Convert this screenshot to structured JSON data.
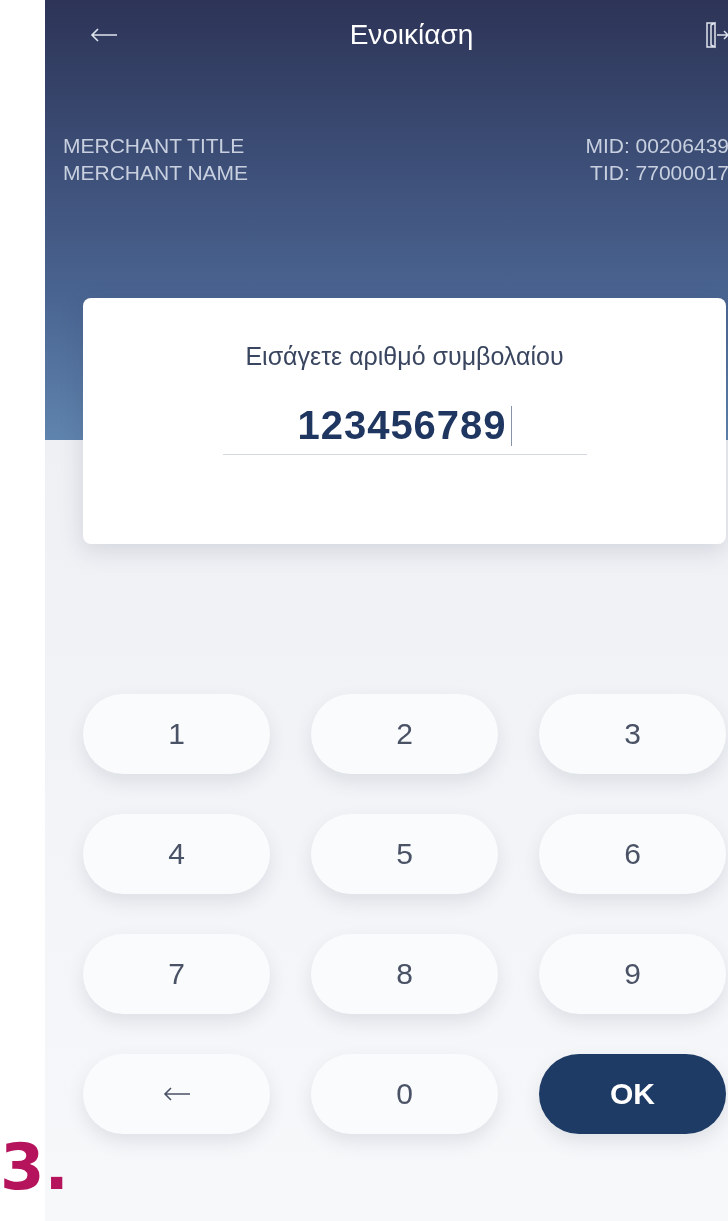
{
  "header": {
    "title": "Ενοικίαση"
  },
  "merchant": {
    "title": "MERCHANT TITLE",
    "name": "MERCHANT NAME",
    "mid": "MID: 00206439",
    "tid": "TID: 77000017"
  },
  "contract_card": {
    "label": "Εισάγετε αριθμό συμβολαίου",
    "value": "123456789",
    "focused": true
  },
  "keypad": [
    {
      "kind": "digit",
      "label": "1"
    },
    {
      "kind": "digit",
      "label": "2"
    },
    {
      "kind": "digit",
      "label": "3"
    },
    {
      "kind": "digit",
      "label": "4"
    },
    {
      "kind": "digit",
      "label": "5"
    },
    {
      "kind": "digit",
      "label": "6"
    },
    {
      "kind": "digit",
      "label": "7"
    },
    {
      "kind": "digit",
      "label": "8"
    },
    {
      "kind": "digit",
      "label": "9"
    },
    {
      "kind": "backspace"
    },
    {
      "kind": "digit",
      "label": "0"
    },
    {
      "kind": "ok",
      "label": "OK"
    }
  ],
  "figure_label": "3."
}
